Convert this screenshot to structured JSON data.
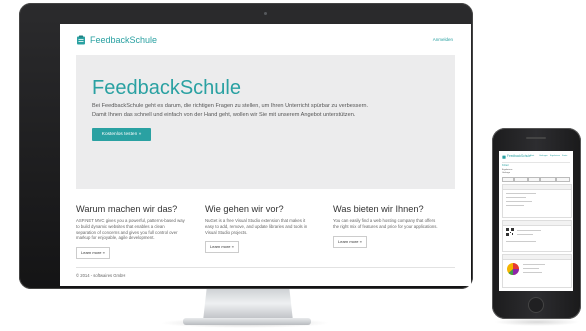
{
  "site": {
    "logo_text": "FeedbackSchule",
    "nav_link": "Anmelden",
    "hero": {
      "title": "FeedbackSchule",
      "lines": [
        "Bei FeedbackSchule geht es darum, die richtigen Fragen zu stellen, um Ihren Unterricht spürbar zu verbessern.",
        "Damit Ihnen das schnell und einfach von der Hand geht, wollen wir Sie mit unserem Angebot unterstützen."
      ],
      "button": "Kostenlos testen »"
    },
    "columns": [
      {
        "heading": "Warum machen wir das?",
        "lines": [
          "ASP.NET MVC gives you a powerful, patterns-based way",
          "to build dynamic websites that enables a clean",
          "separation of concerns and gives you full control over",
          "markup for enjoyable, agile development."
        ],
        "button": "Learn more »"
      },
      {
        "heading": "Wie gehen wir vor?",
        "lines": [
          "NuGet is a free Visual Studio extension that makes it",
          "easy to add, remove, and update libraries and tools in",
          "Visual Studio projects."
        ],
        "button": "Learn more »"
      },
      {
        "heading": "Was bieten wir Ihnen?",
        "lines": [
          "You can easily find a web hosting company that offers",
          "the right mix of features and price for your applications."
        ],
        "button": "Learn more »"
      }
    ],
    "footer": "© 2014 - softwaires GmbH"
  },
  "phone": {
    "logo_text": "FeedbackSchule",
    "nav_items": [
      "Start",
      "Umfragen",
      "Ergebnisse",
      "Konto"
    ],
    "title": "Kriteri",
    "lines": [
      "Ergebnisse",
      "Umfrage"
    ]
  },
  "colors": {
    "accent": "#2aa1a2",
    "hero_bg": "#ececed"
  }
}
